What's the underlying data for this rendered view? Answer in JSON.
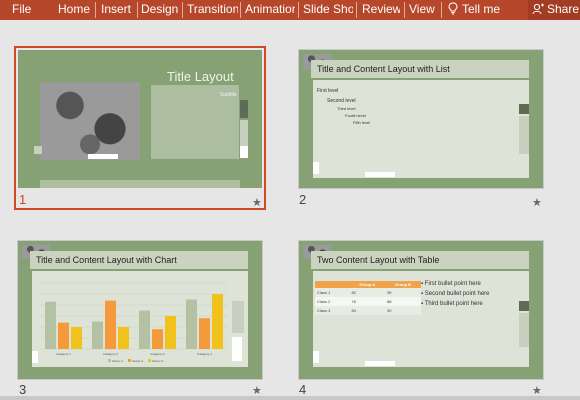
{
  "ribbon": {
    "tabs": [
      "File",
      "Home",
      "Insert",
      "Design",
      "Transitions",
      "Animations",
      "Slide Show",
      "Review",
      "View"
    ],
    "tell_me": "Tell me",
    "share": "Share"
  },
  "slides": [
    {
      "number": "1",
      "title": "Title Layout",
      "subtitle": "Subtitle",
      "selected": true
    },
    {
      "number": "2",
      "title": "Title and Content Layout with List",
      "bullets": [
        "First level",
        "Second level",
        "Third level",
        "Fourth level",
        "Fifth level"
      ]
    },
    {
      "number": "3",
      "title": "Title and Content Layout with Chart",
      "chart_data": {
        "type": "bar",
        "categories": [
          "Category 1",
          "Category 2",
          "Category 3",
          "Category 4"
        ],
        "series": [
          {
            "name": "Series 1",
            "values": [
              4.3,
              2.5,
              3.5,
              4.5
            ]
          },
          {
            "name": "Series 2",
            "values": [
              2.4,
              4.4,
              1.8,
              2.8
            ]
          },
          {
            "name": "Series 3",
            "values": [
              2.0,
              2.0,
              3.0,
              5.0
            ]
          }
        ],
        "ylim": [
          0,
          6
        ],
        "legend": "bottom",
        "grid": true
      }
    },
    {
      "number": "4",
      "title": "Two Content Layout with Table",
      "table": {
        "headers": [
          "",
          "Group A",
          "Group B"
        ],
        "rows": [
          [
            "Class 1",
            "82",
            "95"
          ],
          [
            "Class 2",
            "76",
            "88"
          ],
          [
            "Class 3",
            "84",
            "90"
          ]
        ]
      },
      "bullets": [
        "First bullet point here",
        "Second bullet point here",
        "Third bullet point here"
      ]
    }
  ],
  "colors": {
    "accent": "#b7472a",
    "selection": "#d24726",
    "slide_bg": "#86a174",
    "series": [
      "#b4c1a3",
      "#f59a3a",
      "#f2c21c"
    ]
  }
}
